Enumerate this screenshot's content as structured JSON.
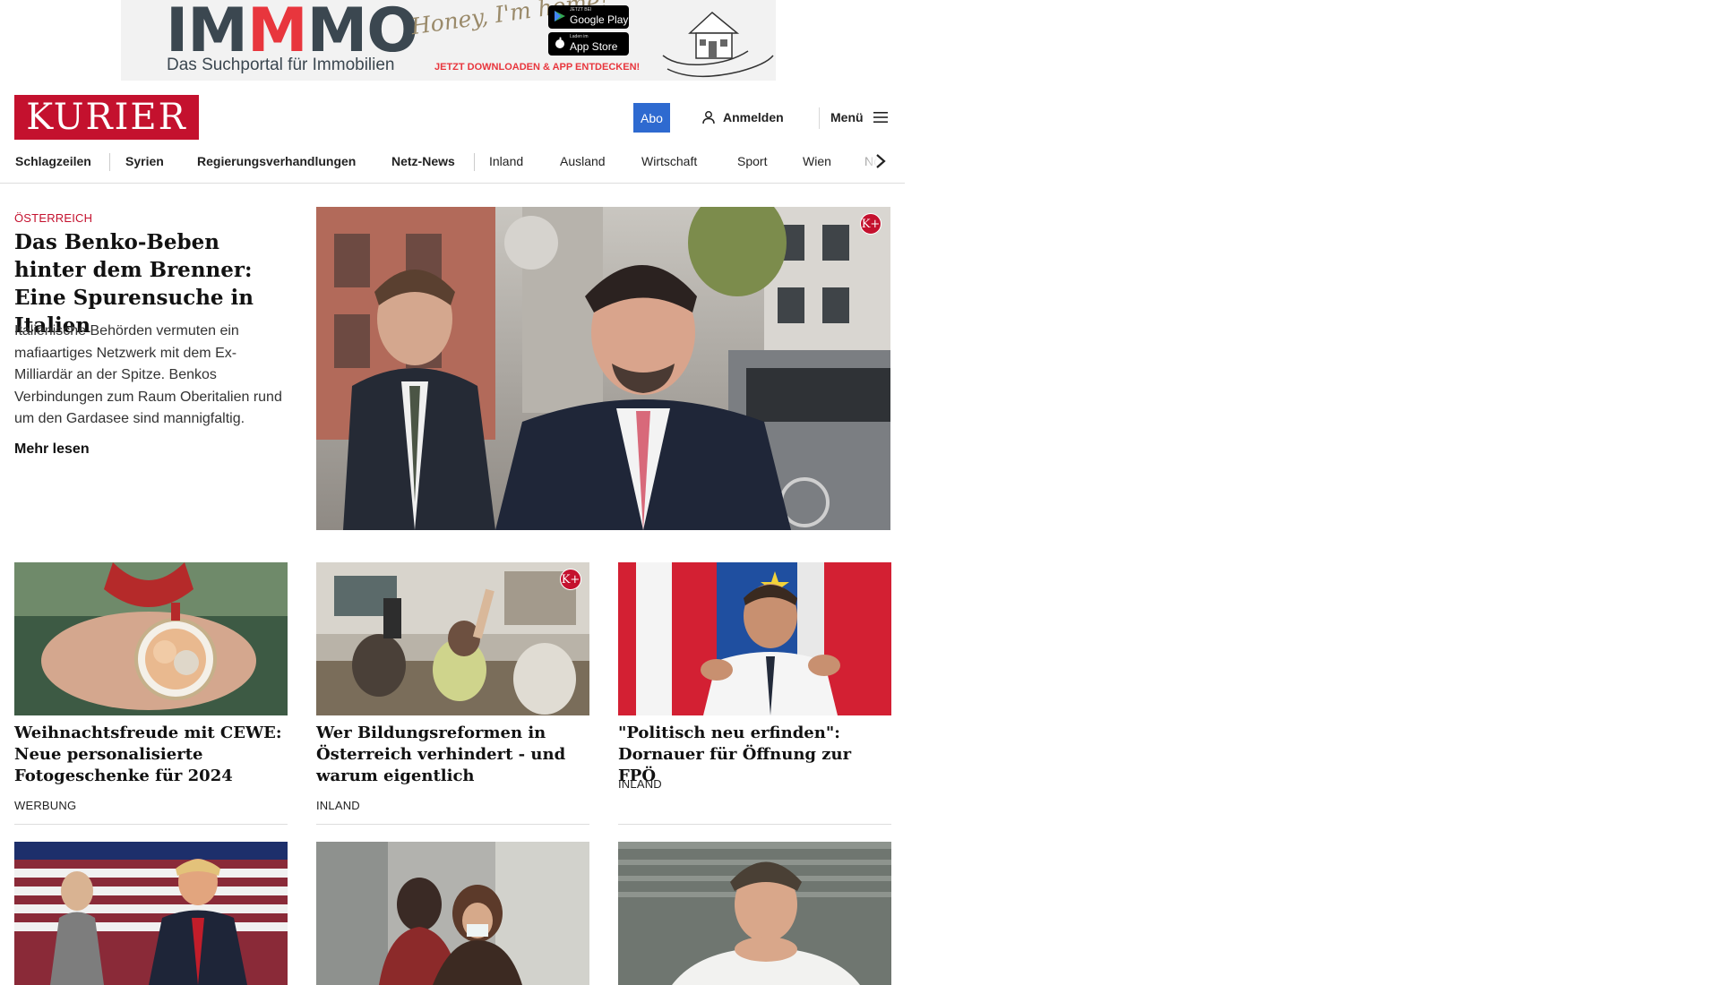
{
  "ad": {
    "logo_a": "IM",
    "logo_b": "M",
    "logo_c": "MO",
    "tagline": "Das Suchportal für Immobilien",
    "script": "Honey, I'm home!",
    "google_small": "JETZT BEI",
    "google_label": "Google Play",
    "apple_small": "Laden im",
    "apple_label": "App Store",
    "cta": "JETZT DOWNLOADEN & APP ENTDECKEN!"
  },
  "header": {
    "logo_text": "KURIER",
    "abo_label": "Abo",
    "login_label": "Anmelden",
    "menu_label": "Menü"
  },
  "nav": {
    "items": [
      "Schlagzeilen",
      "Syrien",
      "Regierungsverhandlungen",
      "Netz-News",
      "Inland",
      "Ausland",
      "Wirtschaft",
      "Sport",
      "Wien",
      "Nö"
    ]
  },
  "hero": {
    "kicker": "ÖSTERREICH",
    "title": "Das Benko-Beben hinter dem Brenner: Eine Spu­rensuche in Italien",
    "teaser": "Italienische Behörden vermuten ein mafiaartiges Netzwerk mit dem Ex-Milliardär an der Spitze. Benkos Verbindungen zum Raum Oberitalien rund um den Gardasee sind mannigfaltig.",
    "more_label": "Mehr lesen",
    "badge": "K+"
  },
  "cards": [
    {
      "title": "Weihnachtsfreude mit CEWE: Neue personalisierte Fotogeschenke für 2024",
      "tag": "WERBUNG"
    },
    {
      "title": "Wer Bildungsreformen in Öster­reich verhindert - und warum eigentlich",
      "tag": "INLAND",
      "badge": "K+"
    },
    {
      "title": "\"Politisch neu erfinden\": Dornauer für Öffnung zur FPÖ",
      "tag": "INLAND"
    }
  ],
  "colors": {
    "brand": "#c4112e",
    "abo": "#2e6ad0"
  }
}
